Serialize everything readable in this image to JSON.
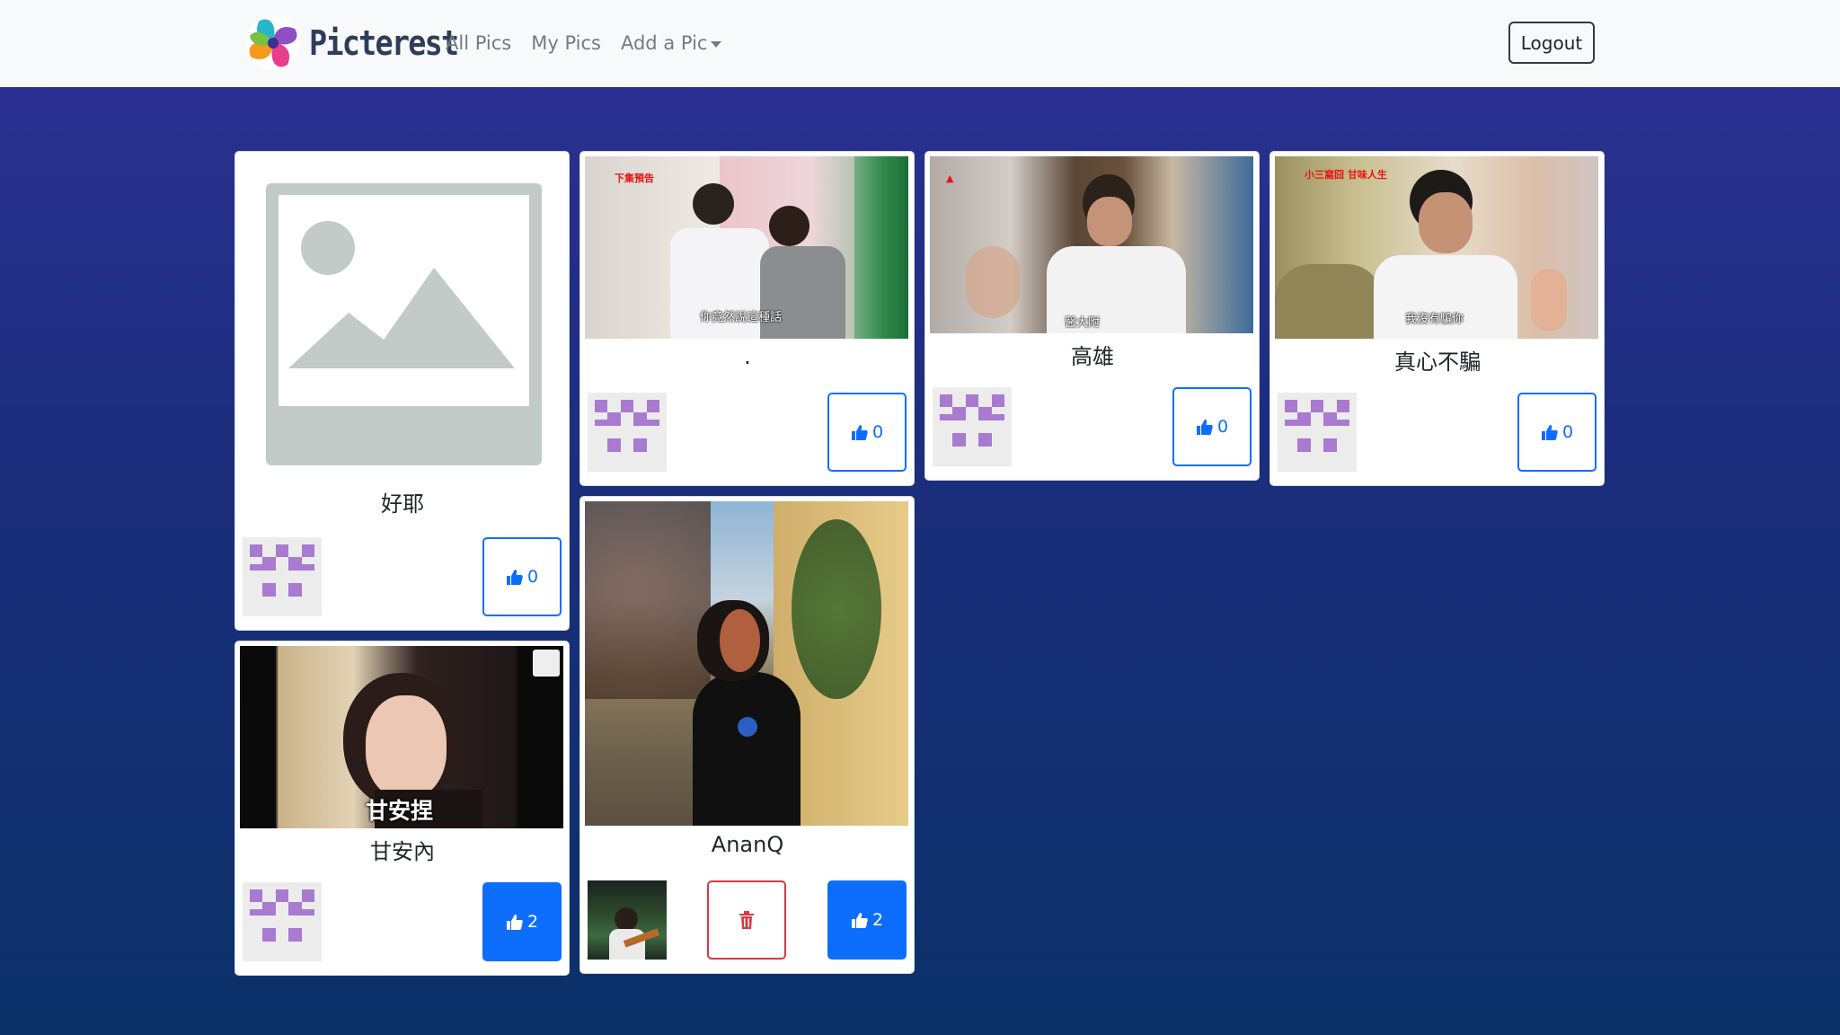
{
  "navbar": {
    "brand": "Picterest",
    "links": [
      {
        "label": "All Pics"
      },
      {
        "label": "My Pics"
      },
      {
        "label": "Add a Pic"
      }
    ],
    "logout_label": "Logout"
  },
  "pics": [
    {
      "title": "好耶",
      "likes": "0",
      "liked": false
    },
    {
      "title": ".",
      "likes": "0",
      "liked": false,
      "overlay": "下集預告",
      "caption": "你竟然說這種話"
    },
    {
      "title": "高雄",
      "likes": "0",
      "liked": false,
      "caption": "醫大附"
    },
    {
      "title": "真心不騙",
      "likes": "0",
      "liked": false,
      "overlay": "小三窩囧 甘味人生",
      "caption": "我沒有騙你"
    },
    {
      "title": "甘安內",
      "likes": "2",
      "liked": true,
      "subtitle": "甘安捏"
    },
    {
      "title": "AnanQ",
      "likes": "2",
      "liked": true,
      "deletable": true
    }
  ],
  "colors": {
    "primary": "#0d6efd",
    "danger": "#dc3545",
    "identicon": "#a87ad0",
    "placeholder": "#c2cbc8"
  }
}
